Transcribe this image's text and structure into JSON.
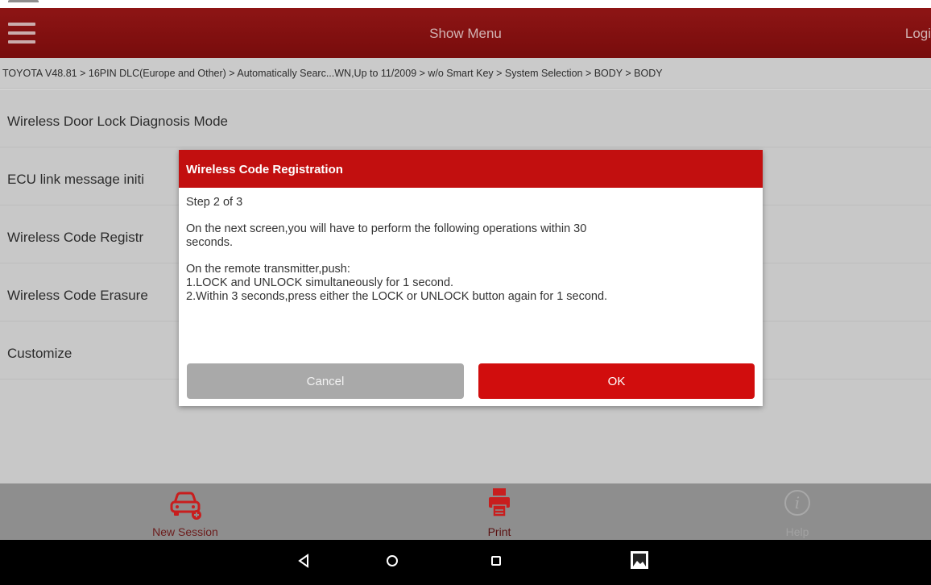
{
  "appbar": {
    "title": "Show Menu",
    "login_label": "Logi"
  },
  "breadcrumb": "TOYOTA V48.81 > 16PIN DLC(Europe and Other) > Automatically Searc...WN,Up to 11/2009 > w/o Smart Key > System Selection > BODY > BODY",
  "menu": {
    "items": [
      {
        "label": "Wireless Door Lock Diagnosis Mode"
      },
      {
        "label": "ECU link message initi"
      },
      {
        "label": "Wireless Code Registr"
      },
      {
        "label": "Wireless Code Erasure"
      },
      {
        "label": "Customize"
      }
    ]
  },
  "dialog": {
    "title": "Wireless Code Registration",
    "step": "Step 2 of 3",
    "line1": "On the next screen,you will have to perform the following operations within 30",
    "line2": "seconds.",
    "line3": "On the remote transmitter,push:",
    "line4": "1.LOCK and UNLOCK simultaneously for 1 second.",
    "line5": "2.Within 3 seconds,press either the LOCK or UNLOCK button again for 1 second.",
    "cancel_label": "Cancel",
    "ok_label": "OK"
  },
  "toolbar": {
    "new_session": "New Session",
    "print": "Print",
    "help": "Help"
  },
  "icons": {
    "menu": "hamburger-icon",
    "new_session": "car-icon",
    "print": "printer-icon",
    "help": "info-icon",
    "back": "back-triangle-icon",
    "home": "home-circle-icon",
    "recents": "recents-square-icon",
    "gallery": "image-icon"
  },
  "colors": {
    "appbar": "#a31818",
    "accent": "#d10d0d",
    "dialog_header": "#c20f0f",
    "toolbar_icon": "#c81e1e"
  }
}
